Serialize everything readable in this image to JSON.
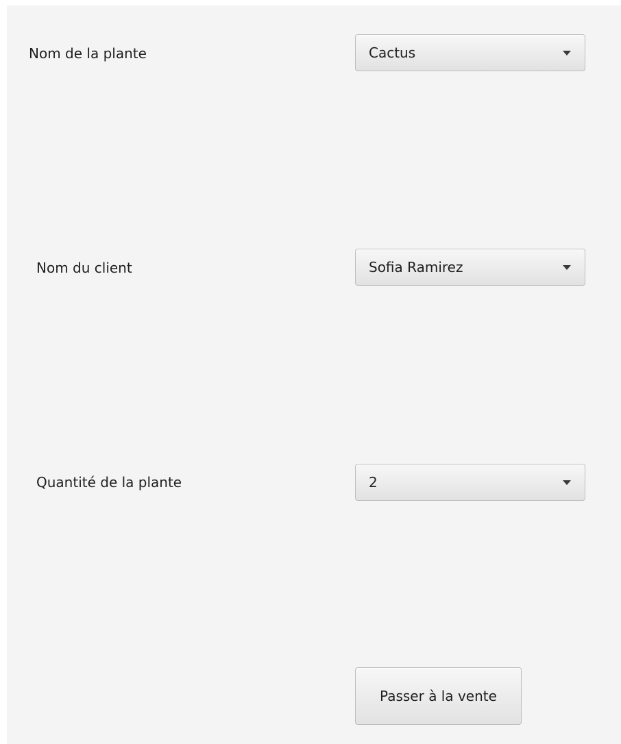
{
  "form": {
    "plant_name": {
      "label": "Nom de la plante",
      "selected": "Cactus"
    },
    "client_name": {
      "label": "Nom du client",
      "selected": "Sofia Ramirez"
    },
    "quantity": {
      "label": "Quantité de la plante",
      "selected": "2"
    },
    "submit_label": "Passer à la vente"
  },
  "icons": {
    "dropdown": "chevron-down-icon"
  },
  "colors": {
    "background": "#f4f4f4",
    "control_border": "#bdbdbd",
    "text": "#1f1f1f"
  }
}
